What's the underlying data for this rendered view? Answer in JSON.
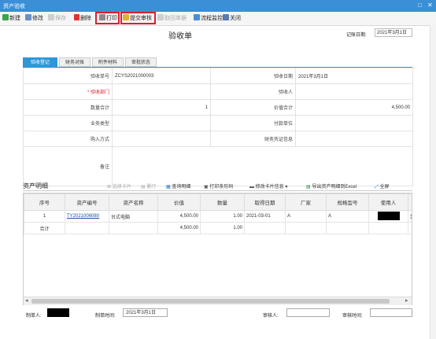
{
  "window": {
    "title": "资产验收",
    "max_glyph": "□",
    "close_glyph": "✕"
  },
  "toolbar": {
    "new": "新建",
    "edit": "修改",
    "save": "保存",
    "delete": "删除",
    "print": "打印",
    "submit": "提交审核",
    "withdraw": "取回单据",
    "process": "流程监控",
    "close": "关闭"
  },
  "doc": {
    "title": "验收单",
    "date_label": "记账日期:",
    "date_value": "2021年3月1日"
  },
  "tabs": [
    "验收登记",
    "财务对账",
    "附件材料",
    "审批状态"
  ],
  "form": {
    "receipt_no_label": "验收单号",
    "receipt_no_value": "ZCYS2021000003",
    "acceptance_date_label": "验收日期",
    "acceptance_date_value": "2021年3月1日",
    "dept_label": "* 验收部门",
    "acceptor_label": "验收人",
    "qty_total_label": "数量合计",
    "qty_total_value": "1",
    "value_total_label": "价值合计",
    "value_total_value": "4,500.00",
    "business_type_label": "业务类型",
    "payment_unit_label": "付款单位",
    "purchase_method_label": "购入方式",
    "voucher_info_label": "财务凭证信息",
    "remarks_label": "备注"
  },
  "detail": {
    "title": "资产明细",
    "toolbar": {
      "select_card": "选择卡片",
      "delete_row": "删行",
      "query_detail": "查询明细",
      "print_barcode": "打印条形码",
      "modify_card": "修改卡片信息",
      "export_excel": "导出资产明细到Excel",
      "fullscreen": "全屏"
    },
    "columns": [
      "序号",
      "资产编号",
      "资产名称",
      "价值",
      "数量",
      "取得日期",
      "厂家",
      "规格型号",
      "使用人",
      "存"
    ],
    "rows": [
      {
        "index": "1",
        "asset_no": "TY2021006080",
        "name": "台式电脑",
        "value": "4,500.00",
        "qty": "1.00",
        "date": "2021-03-01",
        "maker": "A",
        "spec": "A",
        "storage": "某全"
      }
    ],
    "total": {
      "label": "合计",
      "value": "4,500.00",
      "qty": "1.00"
    }
  },
  "footer": {
    "creator_label": "制单人:",
    "create_time_label": "制单时间:",
    "create_time_value": "2021年3月1日",
    "reviewer_label": "审核人:",
    "review_time_label": "审核时间:"
  },
  "colors": {
    "accent": "#2d97d8",
    "titlebar": "#3a8fd6",
    "highlight": "#d9202f"
  }
}
